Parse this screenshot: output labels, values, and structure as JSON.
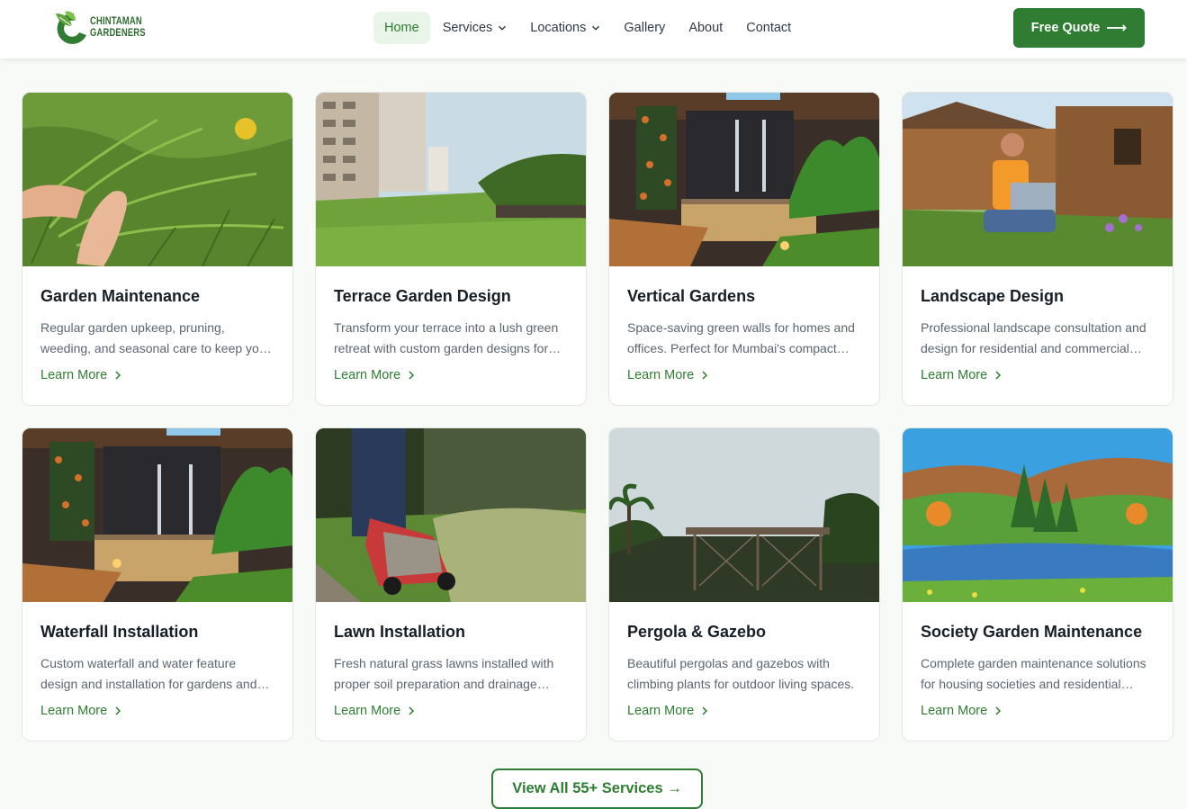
{
  "brand": {
    "line1": "CHINTAMAN",
    "line2": "GARDENERS",
    "logo_icon": "leaf-c-logo",
    "accent": "#2e7d32"
  },
  "nav": {
    "items": [
      {
        "label": "Home",
        "active": true
      },
      {
        "label": "Services",
        "dropdown": true
      },
      {
        "label": "Locations",
        "dropdown": true
      },
      {
        "label": "Gallery"
      },
      {
        "label": "About"
      },
      {
        "label": "Contact"
      }
    ],
    "cta": {
      "label": "Free Quote",
      "icon": "arrow-right-icon"
    }
  },
  "services": [
    {
      "title": "Garden Maintenance",
      "description": "Regular garden upkeep, pruning, weeding, and seasonal care to keep yo…",
      "link": "Learn More"
    },
    {
      "title": "Terrace Garden Design",
      "description": "Transform your terrace into a lush green retreat with custom garden designs for…",
      "link": "Learn More"
    },
    {
      "title": "Vertical Gardens",
      "description": "Space-saving green walls for homes and offices. Perfect for Mumbai's compact…",
      "link": "Learn More"
    },
    {
      "title": "Landscape Design",
      "description": "Professional landscape consultation and design for residential and commercial…",
      "link": "Learn More"
    },
    {
      "title": "Waterfall Installation",
      "description": "Custom waterfall and water feature design and installation for gardens and…",
      "link": "Learn More"
    },
    {
      "title": "Lawn Installation",
      "description": "Fresh natural grass lawns installed with proper soil preparation and drainage…",
      "link": "Learn More"
    },
    {
      "title": "Pergola & Gazebo",
      "description": "Beautiful pergolas and gazebos with climbing plants for outdoor living spaces.",
      "link": "Learn More"
    },
    {
      "title": "Society Garden Maintenance",
      "description": "Complete garden maintenance solutions for housing societies and residential…",
      "link": "Learn More"
    }
  ],
  "view_all": {
    "label": "View All 55+ Services →"
  }
}
